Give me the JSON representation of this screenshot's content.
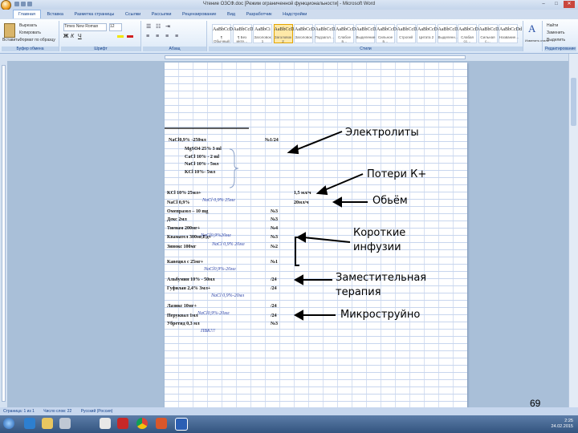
{
  "window": {
    "title": "Чтение ОЗСФ.doc [Режим ограниченной функциональности] - Microsoft Word",
    "min": "–",
    "max": "□",
    "close": "✕"
  },
  "ribbon": {
    "tabs": [
      "Главная",
      "Вставка",
      "Разметка страницы",
      "Ссылки",
      "Рассылки",
      "Рецензирование",
      "Вид",
      "Разработчик",
      "Надстройки"
    ],
    "active_tab": "Главная",
    "clipboard": {
      "paste": "Вставить",
      "cut": "Вырезать",
      "copy": "Копировать",
      "format": "Формат по образцу",
      "label": "Буфер обмена"
    },
    "font": {
      "name": "Times New Roman",
      "size": "12",
      "label": "Шрифт"
    },
    "paragraph": {
      "label": "Абзац"
    },
    "styles": {
      "label": "Стили",
      "items": [
        {
          "sample": "AaBbCcDd",
          "name": "¶ Обычный"
        },
        {
          "sample": "AaBbCcDd",
          "name": "¶ Без инте…"
        },
        {
          "sample": "AaBbCi",
          "name": "Заголовок 1"
        },
        {
          "sample": "AaBbCcDd",
          "name": "Заголовок 2"
        },
        {
          "sample": "AaBbCcDd",
          "name": "Заголовок"
        },
        {
          "sample": "AaBbCcDd",
          "name": "Подзагол…"
        },
        {
          "sample": "AaBbCcDd",
          "name": "Слабое в…"
        },
        {
          "sample": "AaBbCcDd",
          "name": "Выделение"
        },
        {
          "sample": "AaBbCcDd",
          "name": "Сильное в…"
        },
        {
          "sample": "AaBbCcDd",
          "name": "Строгий"
        },
        {
          "sample": "AaBbCcDd",
          "name": "Цитата 2"
        },
        {
          "sample": "AaBbCcDd",
          "name": "Выделенн…"
        },
        {
          "sample": "AaBbCcDd",
          "name": "Слабая сс…"
        },
        {
          "sample": "AaBbCcDd",
          "name": "Сильная с…"
        },
        {
          "sample": "AaBbCcDd",
          "name": "Название…"
        }
      ],
      "change": "Изменить стили"
    },
    "editing": {
      "find": "Найти",
      "replace": "Заменить",
      "select": "Выделить",
      "label": "Редактирование"
    }
  },
  "document_lines": [
    {
      "text": "NaCl0,9% -250мл",
      "right": "№1/24"
    },
    {
      "text": "MgSO4 25% 3 ml"
    },
    {
      "text": "CaCl 10% - 2 ml"
    },
    {
      "text": "NaCl 10% - 5мл"
    },
    {
      "text": "KCl 10%- 5мл"
    },
    {
      "text": "KCl 10% 25мл+",
      "blue": "NaCl 0,9% 25мл",
      "right": "1,5 мл/ч"
    },
    {
      "text": "NaCl 0,9%",
      "right": "20мл/ч"
    },
    {
      "text": "Омепразол – 10 mg",
      "right": "№3"
    },
    {
      "text": "Декс 2мл",
      "right": "№3"
    },
    {
      "text": "Тиенам 200мг+",
      "blue": "NaCl0,9%20мл",
      "right": "№4"
    },
    {
      "text": "Квамател 300мг,Ед+",
      "blue": "NaCl 0,9% 20мл",
      "right": "№3"
    },
    {
      "text": "Зинокс 100мг",
      "right": "№2"
    },
    {
      "text": "Кавецил с 25мг+",
      "blue": "NaCl0,9%-20мл",
      "right": "№1"
    },
    {
      "text": "Альбумин 10% - 50мл",
      "right": "/24"
    },
    {
      "text": "Гуфилан 2,4% 3мл+",
      "blue": "NaCl 0,9%-20мл",
      "right": "/24"
    },
    {
      "text": "Лазикс 10мг+",
      "blue": "NaCl0,9%-20мл",
      "right": "/24"
    },
    {
      "text": "Перуквал 1мл",
      "right": "/24"
    },
    {
      "text": "Убретид 0,3 мл",
      "blue": "ПВК!!!",
      "right": "№3"
    }
  ],
  "annotations": {
    "electrolytes": "Электролиты",
    "potassium": "Потери К+",
    "volume": "Обьём",
    "short_infusions": [
      "Короткие",
      "инфузии"
    ],
    "replacement": [
      "Заместительная",
      "терапия"
    ],
    "microjet": "Микроструйно"
  },
  "page_number": "69",
  "status_bar": {
    "page": "Страница: 1 из 1",
    "words": "Число слов: 22",
    "language": "Русский (Россия)"
  },
  "taskbar": {
    "time": "2:25",
    "date": "24.02.2015"
  }
}
